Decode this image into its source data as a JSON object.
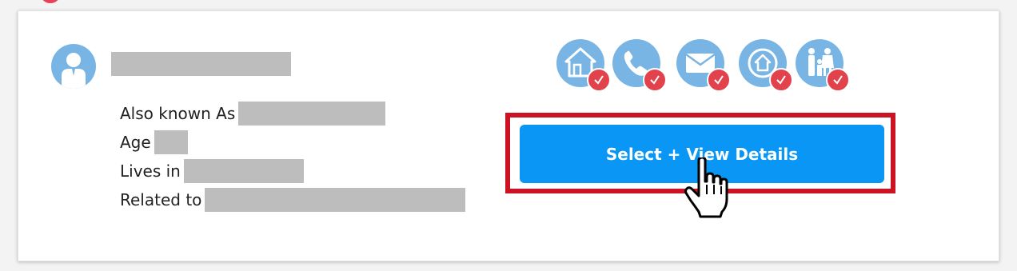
{
  "result_card": {
    "info": {
      "aka_label": "Also known As",
      "age_label": "Age",
      "lives_label": "Lives in",
      "related_label": "Related to"
    },
    "features": [
      {
        "icon": "house-icon",
        "checked": true
      },
      {
        "icon": "phone-icon",
        "checked": true
      },
      {
        "icon": "email-icon",
        "checked": true
      },
      {
        "icon": "address-icon",
        "checked": true
      },
      {
        "icon": "family-icon",
        "checked": true
      }
    ],
    "cta_label": "Select + View Details"
  },
  "colors": {
    "accent_blue": "#0a96f4",
    "icon_blue": "#79b5e4",
    "badge_red": "#e2424c",
    "highlight_red": "#cc1323",
    "redaction_gray": "#bdbdbd"
  }
}
